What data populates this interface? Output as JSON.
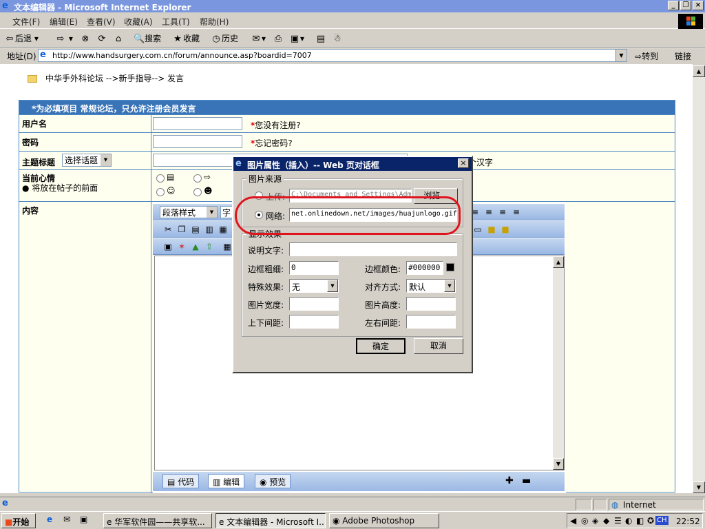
{
  "window": {
    "title": "文本编辑器 - Microsoft Internet Explorer"
  },
  "menu": [
    "文件(F)",
    "编辑(E)",
    "查看(V)",
    "收藏(A)",
    "工具(T)",
    "帮助(H)"
  ],
  "toolbar": {
    "back": "后退",
    "search": "搜索",
    "favorites": "收藏",
    "history": "历史"
  },
  "address": {
    "label": "地址(D)",
    "url": "http://www.handsurgery.com.cn/forum/announce.asp?boardid=7007",
    "go": "转到",
    "links": "链接"
  },
  "page": {
    "breadcrumb": "中华手外科论坛 -->新手指导--> 发言",
    "form_header": "*为必填项目 常规论坛，只允许注册会员发言",
    "username_label": "用户名",
    "not_registered": "您没有注册?",
    "password_label": "密码",
    "forgot_password": "忘记密码?",
    "subject_label": "主题标题",
    "topic_select": "选择话题",
    "subject_hint": "个汉字",
    "mood_label": "当前心情",
    "mood_note": "将放在帖子的前面",
    "content_label": "内容",
    "para_style": "段落样式",
    "font_char": "字",
    "tabs": {
      "code": "代码",
      "edit": "编辑",
      "preview": "预览"
    }
  },
  "dialog": {
    "title": "图片属性（插入）-- Web 页对话框",
    "source_group": "图片来源",
    "upload_label": "上传:",
    "upload_value": "C:\\Documents and Settings\\Adm",
    "browse": "浏览...",
    "network_label": "网络:",
    "network_value": "net.onlinedown.net/images/huajunlogo.gif",
    "display_group": "显示效果",
    "alt_label": "说明文字:",
    "border_width_label": "边框粗细:",
    "border_width_value": "0",
    "border_color_label": "边框颜色:",
    "border_color_value": "#000000",
    "effect_label": "特殊效果:",
    "effect_value": "无",
    "align_label": "对齐方式:",
    "align_value": "默认",
    "width_label": "图片宽度:",
    "height_label": "图片高度:",
    "vspace_label": "上下间距:",
    "hspace_label": "左右间距:",
    "ok": "确定",
    "cancel": "取消"
  },
  "status": {
    "zone": "Internet"
  },
  "taskbar": {
    "start": "开始",
    "tasks": [
      "华军软件园——共享软...",
      "文本编辑器 - Microsoft I...",
      "Adobe Photoshop"
    ],
    "clock": "22:52",
    "lang": "CH"
  },
  "colors": {
    "form_header": "#3a74b8",
    "dialog_title": "#0a246a",
    "highlight_mark": "#e0141e"
  }
}
